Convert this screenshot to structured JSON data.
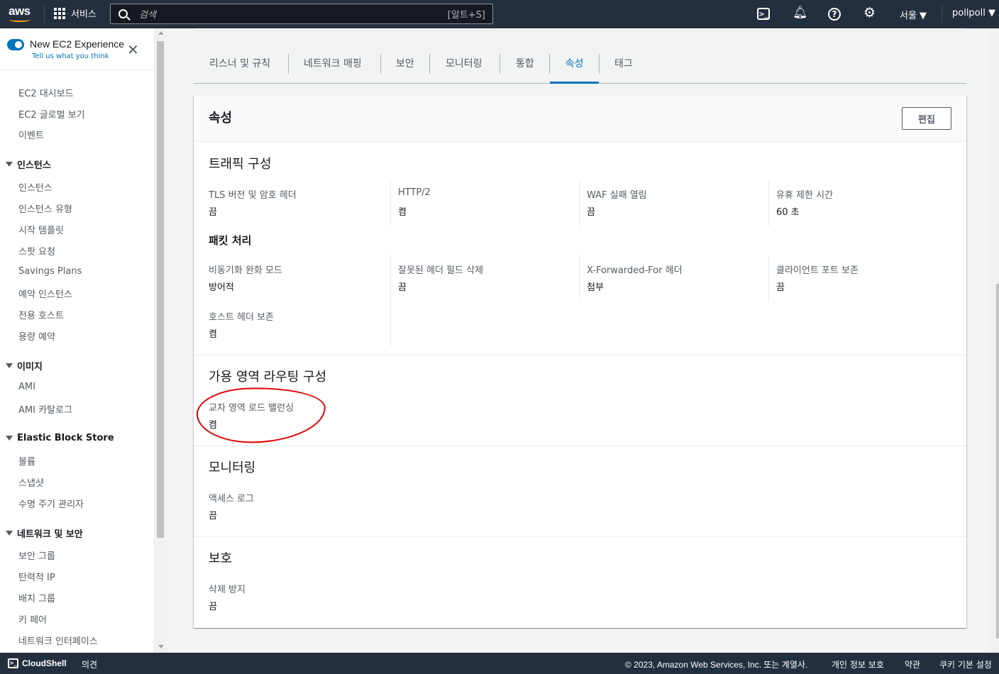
{
  "topnav": {
    "logo": "aws",
    "services_label": "서비스",
    "search_placeholder": "검색",
    "search_shortcut": "[알트+S]",
    "region": "서울 ▼",
    "user": "pollpoll ▼"
  },
  "sidebar": {
    "experience_title": "New EC2 Experience",
    "experience_tell": "Tell us what you think",
    "top_items": [
      "EC2 대시보드",
      "EC2 글로벌 보기",
      "이벤트"
    ],
    "sections": [
      {
        "title": "인스턴스",
        "items": [
          "인스턴스",
          "인스턴스 유형",
          "시작 템플릿",
          "스팟 요청",
          "Savings Plans",
          "예약 인스턴스",
          "전용 호스트",
          "용량 예약"
        ]
      },
      {
        "title": "이미지",
        "items": [
          "AMI",
          "AMI 카탈로그"
        ]
      },
      {
        "title": "Elastic Block Store",
        "items": [
          "볼륨",
          "스냅샷",
          "수명 주기 관리자"
        ]
      },
      {
        "title": "네트워크 및 보안",
        "items": [
          "보안 그룹",
          "탄력적 IP",
          "배치 그룹",
          "키 페어",
          "네트워크 인터페이스"
        ]
      }
    ]
  },
  "tabs": [
    "리스너 및 규칙",
    "네트워크 매핑",
    "보안",
    "모니터링",
    "통합",
    "속성",
    "태그"
  ],
  "active_tab": "속성",
  "panel": {
    "title": "속성",
    "edit_label": "편집",
    "traffic": {
      "title": "트래픽 구성",
      "items": [
        {
          "label": "TLS 버전 및 암호 헤더",
          "value": "끔"
        },
        {
          "label": "HTTP/2",
          "value": "켬"
        },
        {
          "label": "WAF 실패 열림",
          "value": "끔"
        },
        {
          "label": "유휴 제한 시간",
          "value": "60 초"
        }
      ]
    },
    "packet": {
      "title": "패킷 처리",
      "items": [
        {
          "label": "비동기화 완화 모드",
          "value": "방어적"
        },
        {
          "label": "잘못된 헤더 필드 삭제",
          "value": "끔"
        },
        {
          "label": "X-Forwarded-For 헤더",
          "value": "첨부"
        },
        {
          "label": "클라이언트 포트 보존",
          "value": "끔"
        },
        {
          "label": "호스트 헤더 보존",
          "value": "켬"
        }
      ]
    },
    "az_routing": {
      "title": "가용 영역 라우팅 구성",
      "items": [
        {
          "label": "교차 영역 로드 밸런싱",
          "value": "켬"
        }
      ]
    },
    "monitoring": {
      "title": "모니터링",
      "items": [
        {
          "label": "액세스 로그",
          "value": "끔"
        }
      ]
    },
    "protection": {
      "title": "보호",
      "items": [
        {
          "label": "삭제 방지",
          "value": "끔"
        }
      ]
    }
  },
  "footer": {
    "cloudshell": "CloudShell",
    "feedback": "의견",
    "copyright": "© 2023, Amazon Web Services, Inc. 또는 계열사.",
    "privacy": "개인 정보 보호",
    "terms": "약관",
    "cookies": "쿠키 기본 설정"
  },
  "colors": {
    "nav_bg": "#232f3e",
    "accent": "#0073bb",
    "annotation": "#e00000"
  }
}
